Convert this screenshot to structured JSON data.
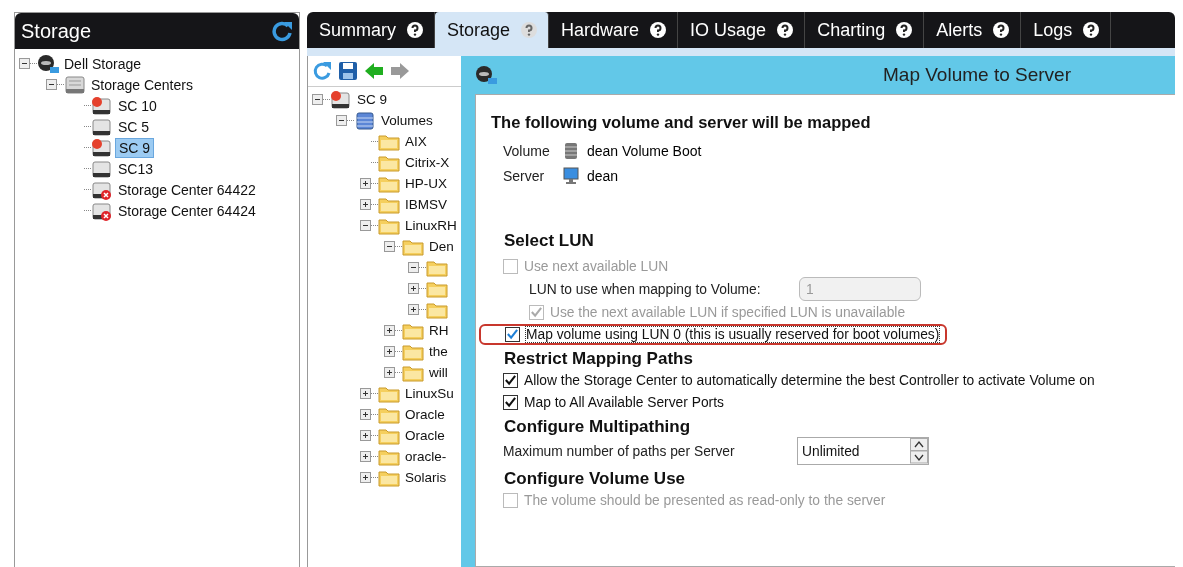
{
  "left_panel": {
    "title": "Storage",
    "tree": [
      {
        "label": "Dell Storage",
        "kind": "dell",
        "expanded": true,
        "selected": false,
        "children": [
          {
            "label": "Storage Centers",
            "kind": "centers",
            "expanded": true,
            "selected": false,
            "children": [
              {
                "label": "SC 10",
                "kind": "sc-alert",
                "selected": false
              },
              {
                "label": "SC 5",
                "kind": "sc",
                "selected": false
              },
              {
                "label": "SC 9",
                "kind": "sc-alert",
                "selected": true
              },
              {
                "label": "SC13",
                "kind": "sc",
                "selected": false
              },
              {
                "label": "Storage Center 64422",
                "kind": "sc-error",
                "selected": false
              },
              {
                "label": "Storage Center 64424",
                "kind": "sc-error",
                "selected": false
              }
            ]
          }
        ]
      }
    ]
  },
  "tabs": [
    {
      "label": "Summary",
      "selected": false
    },
    {
      "label": "Storage",
      "selected": true
    },
    {
      "label": "Hardware",
      "selected": false
    },
    {
      "label": "IO Usage",
      "selected": false
    },
    {
      "label": "Charting",
      "selected": false
    },
    {
      "label": "Alerts",
      "selected": false
    },
    {
      "label": "Logs",
      "selected": false
    }
  ],
  "volume_tree": [
    {
      "label": "SC 9",
      "kind": "sc-alert",
      "expanded": true,
      "children": [
        {
          "label": "Volumes",
          "kind": "volumes",
          "expanded": true,
          "children": [
            {
              "label": "AIX",
              "kind": "folder"
            },
            {
              "label": "Citrix-X",
              "kind": "folder"
            },
            {
              "label": "HP-UX",
              "kind": "folder",
              "expanded": false
            },
            {
              "label": "IBMSV",
              "kind": "folder",
              "expanded": false
            },
            {
              "label": "LinuxRH",
              "kind": "folder",
              "expanded": true,
              "children": [
                {
                  "label": "Den",
                  "kind": "folder",
                  "expanded": true,
                  "children": [
                    {
                      "kind": "folder",
                      "expanded": true
                    },
                    {
                      "kind": "folder",
                      "expanded": false
                    },
                    {
                      "kind": "folder",
                      "expanded": false
                    }
                  ]
                },
                {
                  "label": "RH",
                  "kind": "folder",
                  "expanded": false
                },
                {
                  "label": "the",
                  "kind": "folder",
                  "expanded": false
                },
                {
                  "label": "will",
                  "kind": "folder",
                  "expanded": false
                }
              ]
            },
            {
              "label": "LinuxSu",
              "kind": "folder",
              "expanded": false
            },
            {
              "label": "Oracle",
              "kind": "folder",
              "expanded": false
            },
            {
              "label": "Oracle",
              "kind": "folder",
              "expanded": false
            },
            {
              "label": "oracle-",
              "kind": "folder",
              "expanded": false
            },
            {
              "label": "Solaris",
              "kind": "folder",
              "expanded": false
            }
          ]
        }
      ]
    }
  ],
  "dialog": {
    "title": "Map Volume to Server",
    "heading": "The following volume and server will be mapped",
    "details": [
      {
        "label": "Volume",
        "value": "dean Volume Boot",
        "kind": "volume"
      },
      {
        "label": "Server",
        "value": "dean",
        "kind": "server"
      }
    ],
    "sections": [
      {
        "title": "Select LUN",
        "items": [
          {
            "kind": "checkbox",
            "label": "Use next available LUN",
            "checked": false,
            "disabled": true,
            "highlighted": false,
            "children": [
              {
                "kind": "field",
                "label": "LUN to use when mapping to Volume:",
                "value": "1",
                "disabled": true
              },
              {
                "kind": "checkbox",
                "label": "Use the next available LUN if specified LUN is unavailable",
                "checked": true,
                "disabled": true,
                "highlighted": false
              }
            ]
          },
          {
            "kind": "checkbox",
            "label": "Map volume using LUN 0 (this is usually reserved for boot volumes)",
            "checked": true,
            "disabled": false,
            "highlighted": true
          }
        ]
      },
      {
        "title": "Restrict Mapping Paths",
        "items": [
          {
            "kind": "checkbox",
            "label": "Allow the Storage Center to automatically determine the best Controller to activate Volume on",
            "checked": true,
            "disabled": false,
            "highlighted": false
          },
          {
            "kind": "checkbox",
            "label": "Map to All Available Server Ports",
            "checked": true,
            "disabled": false,
            "highlighted": false
          }
        ]
      },
      {
        "title": "Configure Multipathing",
        "items": [
          {
            "kind": "spinner",
            "label": "Maximum number of paths per Server",
            "value": "Unlimited"
          }
        ]
      },
      {
        "title": "Configure Volume Use",
        "items": [
          {
            "kind": "checkbox",
            "label": "The volume should be presented as read-only to the server",
            "checked": false,
            "disabled": true,
            "highlighted": false
          }
        ]
      }
    ]
  }
}
